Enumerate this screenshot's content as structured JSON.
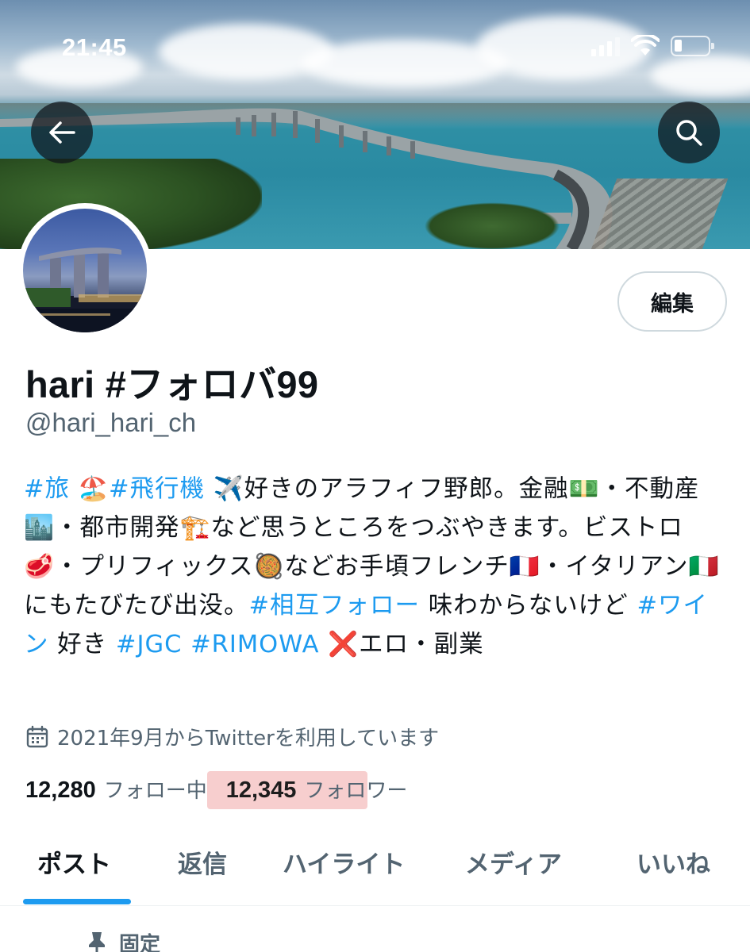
{
  "status_bar": {
    "time": "21:45",
    "icons": [
      "cellular-signal-icon",
      "wifi-icon",
      "battery-icon"
    ]
  },
  "header": {
    "back_icon": "arrow-left-icon",
    "search_icon": "search-icon"
  },
  "profile": {
    "edit_label": "編集",
    "display_name": "hari #フォロバ99",
    "handle": "@hari_hari_ch",
    "bio": [
      {
        "text": "#旅",
        "tag": true
      },
      {
        "text": " 🏖️",
        "tag": false
      },
      {
        "text": "#飛行機",
        "tag": true
      },
      {
        "text": " ✈️好きのアラフィフ野郎。金融💵・不動産🏙️・都市開発🏗️など思うところをつぶやきます。ビストロ🥩・プリフィックス🥘などお手頃フレンチ🇫🇷・イタリアン🇮🇹にもたびたび出没。",
        "tag": false
      },
      {
        "text": "#相互フォロー",
        "tag": true
      },
      {
        "text": " 味わからないけど ",
        "tag": false
      },
      {
        "text": "#ワイン",
        "tag": true
      },
      {
        "text": " 好き ",
        "tag": false
      },
      {
        "text": "#JGC",
        "tag": true
      },
      {
        "text": " ",
        "tag": false
      },
      {
        "text": "#RIMOWA",
        "tag": true
      },
      {
        "text": " ❌エロ・副業",
        "tag": false
      }
    ],
    "joined_icon": "calendar-icon",
    "joined_text": "2021年9月からTwitterを利用しています",
    "following_count": "12,280",
    "following_label": "フォロー中",
    "followers_count": "12,345",
    "followers_label": "フォロワー"
  },
  "tabs": [
    {
      "label": "ポスト",
      "active": true
    },
    {
      "label": "返信",
      "active": false
    },
    {
      "label": "ハイライト",
      "active": false
    },
    {
      "label": "メディア",
      "active": false
    },
    {
      "label": "いいね",
      "active": false
    }
  ],
  "pinned": {
    "icon": "pin-icon",
    "label": "固定"
  },
  "colors": {
    "link": "#1d9bf0",
    "text": "#0f1419",
    "muted": "#536471",
    "highlight": "#f4bebe"
  }
}
